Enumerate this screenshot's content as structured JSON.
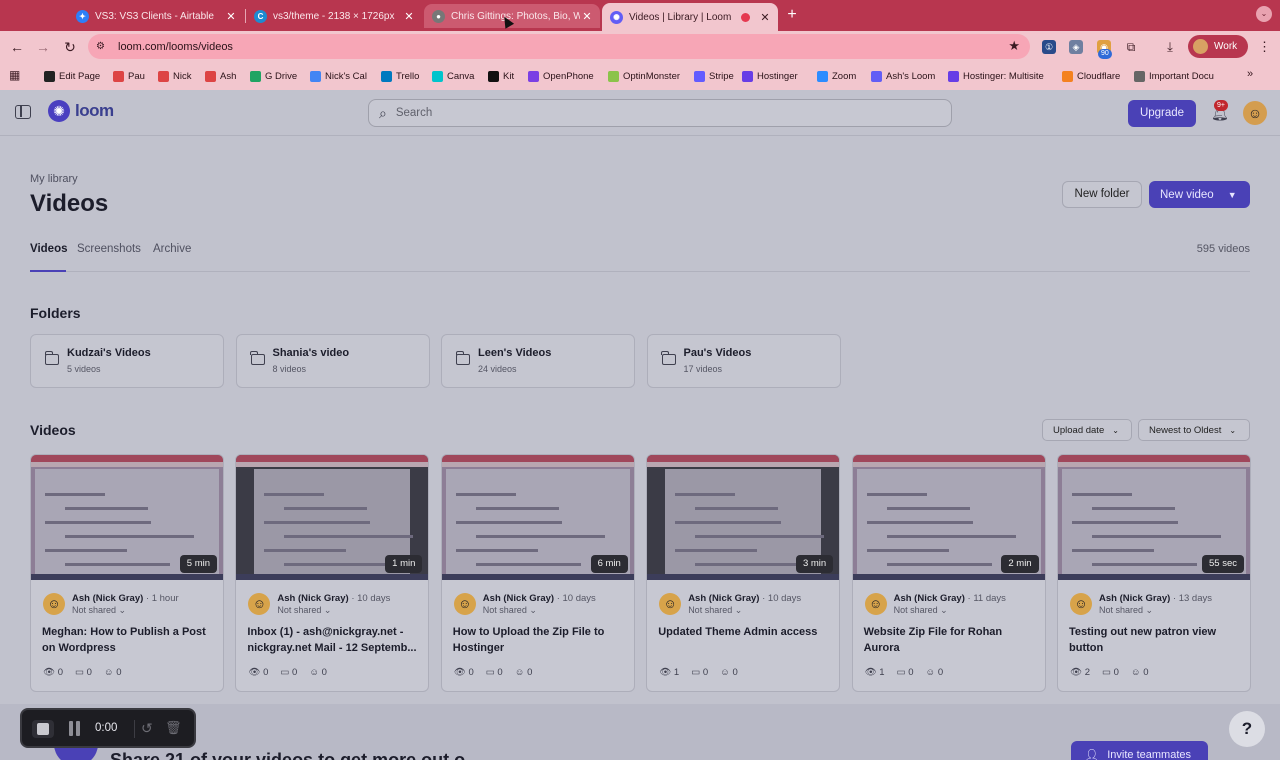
{
  "browser": {
    "tabs": [
      {
        "title": "VS3: VS3 Clients - Airtable",
        "icon": "star-icon",
        "color": "#2d7ff9"
      },
      {
        "title": "vs3/theme - 2138 × 1726px",
        "icon": "canva-icon",
        "color": "#1d8bd1"
      },
      {
        "title": "Chris Gittings: Photos, Bio, W",
        "icon": "avatar-icon",
        "color": "#777"
      },
      {
        "title": "Videos | Library | Loom",
        "icon": "loom-icon",
        "color": "#625df5"
      }
    ],
    "new_tab": "+",
    "url": "loom.com/looms/videos",
    "profile": "Work",
    "ext_badge": "90"
  },
  "bookmarks": [
    {
      "label": "Edit Page",
      "color": "#222"
    },
    {
      "label": "Pau",
      "color": "#d44"
    },
    {
      "label": "Nick",
      "color": "#d44"
    },
    {
      "label": "Ash",
      "color": "#d44"
    },
    {
      "label": "G Drive",
      "color": "#1fa463"
    },
    {
      "label": "Nick's Cal",
      "color": "#4285f4"
    },
    {
      "label": "Trello",
      "color": "#0079bf"
    },
    {
      "label": "Canva",
      "color": "#00c4cc"
    },
    {
      "label": "Kit",
      "color": "#111"
    },
    {
      "label": "OpenPhone",
      "color": "#7b3fe4"
    },
    {
      "label": "OptinMonster",
      "color": "#8bc34a"
    },
    {
      "label": "Stripe",
      "color": "#635bff"
    },
    {
      "label": "Hostinger",
      "color": "#673de6"
    },
    {
      "label": "Zoom",
      "color": "#2d8cff"
    },
    {
      "label": "Ash's Loom",
      "color": "#625df5"
    },
    {
      "label": "Hostinger: Multisite",
      "color": "#673de6"
    },
    {
      "label": "Cloudflare",
      "color": "#f48120"
    },
    {
      "label": "Important Docu",
      "color": "#666"
    }
  ],
  "app": {
    "logo": "loom",
    "search_placeholder": "Search",
    "upgrade": "Upgrade",
    "notif_badge": "9+"
  },
  "library": {
    "breadcrumb": "My library",
    "title": "Videos",
    "new_folder": "New folder",
    "new_video": "New video",
    "tabs": [
      "Videos",
      "Screenshots",
      "Archive"
    ],
    "count": "595 videos"
  },
  "folders": {
    "heading": "Folders",
    "items": [
      {
        "name": "Kudzai's Videos",
        "count": "5 videos"
      },
      {
        "name": "Shania's video",
        "count": "8 videos"
      },
      {
        "name": "Leen's Videos",
        "count": "24 videos"
      },
      {
        "name": "Pau's Videos",
        "count": "17 videos"
      }
    ]
  },
  "videos": {
    "heading": "Videos",
    "sort_field": "Upload date",
    "sort_order": "Newest to Oldest",
    "items": [
      {
        "duration": "5 min",
        "author": "Ash (Nick Gray)",
        "when": "· 1 hour",
        "share": "Not shared ⌄",
        "title": "Meghan: How to Publish a Post on Wordpress",
        "views": "0",
        "comments": "0",
        "reactions": "0"
      },
      {
        "duration": "1 min",
        "author": "Ash (Nick Gray)",
        "when": "· 10 days",
        "share": "Not shared ⌄",
        "title": "Inbox (1) - ash@nickgray.net - nickgray.net Mail - 12 Septemb...",
        "views": "0",
        "comments": "0",
        "reactions": "0"
      },
      {
        "duration": "6 min",
        "author": "Ash (Nick Gray)",
        "when": "· 10 days",
        "share": "Not shared ⌄",
        "title": "How to Upload the Zip File to Hostinger",
        "views": "0",
        "comments": "0",
        "reactions": "0"
      },
      {
        "duration": "3 min",
        "author": "Ash (Nick Gray)",
        "when": "· 10 days",
        "share": "Not shared ⌄",
        "title": "Updated Theme Admin access",
        "views": "1",
        "comments": "0",
        "reactions": "0"
      },
      {
        "duration": "2 min",
        "author": "Ash (Nick Gray)",
        "when": "· 11 days",
        "share": "Not shared ⌄",
        "title": "Website Zip File for Rohan Aurora",
        "views": "1",
        "comments": "0",
        "reactions": "0"
      },
      {
        "duration": "55 sec",
        "author": "Ash (Nick Gray)",
        "when": "· 13 days",
        "share": "Not shared ⌄",
        "title": "Testing out new patron view button",
        "views": "2",
        "comments": "0",
        "reactions": "0"
      }
    ]
  },
  "bottom": {
    "text": "Share 21 of your videos to get more out o",
    "invite": "Invite teammates",
    "help": "?"
  },
  "recorder": {
    "time": "0:00"
  }
}
